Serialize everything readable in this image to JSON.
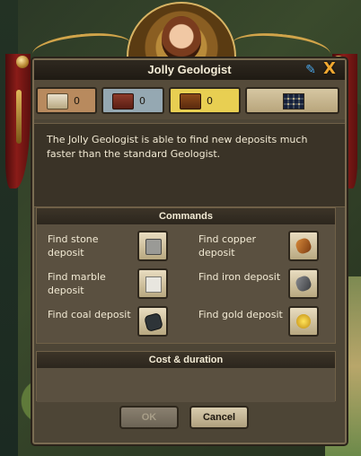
{
  "window": {
    "title": "Jolly Geologist",
    "accent": "#d8b464"
  },
  "header_icons": {
    "edit_icon": "pencil-icon",
    "close_icon": "close-icon",
    "close_glyph": "X"
  },
  "tabs": [
    {
      "name": "paper-book",
      "count": "0",
      "color": "#b88a5e"
    },
    {
      "name": "red-book",
      "count": "0",
      "color": "#95a8b2"
    },
    {
      "name": "brown-book",
      "count": "0",
      "color": "#e8cf52"
    },
    {
      "name": "grid",
      "count": "",
      "color": "#d6c7a2"
    }
  ],
  "description": "The Jolly Geologist is able to find new deposits much faster than the standard Geologist.",
  "commands": {
    "heading": "Commands",
    "items": [
      {
        "label": "Find stone deposit",
        "icon": "stone-icon"
      },
      {
        "label": "Find copper deposit",
        "icon": "copper-icon"
      },
      {
        "label": "Find marble deposit",
        "icon": "marble-icon"
      },
      {
        "label": "Find iron deposit",
        "icon": "iron-icon"
      },
      {
        "label": "Find coal deposit",
        "icon": "coal-icon"
      },
      {
        "label": "Find gold deposit",
        "icon": "gold-icon"
      }
    ]
  },
  "cost": {
    "heading": "Cost & duration"
  },
  "buttons": {
    "ok": "OK",
    "cancel": "Cancel"
  }
}
